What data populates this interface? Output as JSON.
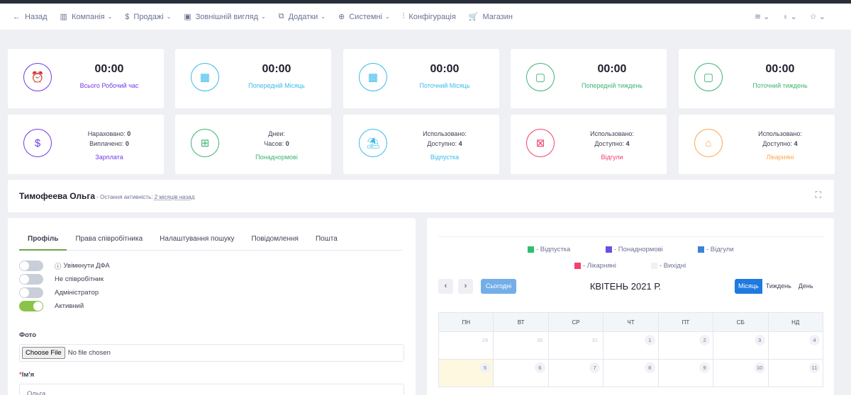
{
  "nav": {
    "items": [
      {
        "icon": "←",
        "label": "Назад",
        "chevron": false
      },
      {
        "icon": "▥",
        "label": "Компанія",
        "chevron": true
      },
      {
        "icon": "$",
        "label": "Продажі",
        "chevron": true
      },
      {
        "icon": "▣",
        "label": "Зовнішній вигляд",
        "chevron": true
      },
      {
        "icon": "⧉",
        "label": "Додатки",
        "chevron": true
      },
      {
        "icon": "⊕",
        "label": "Системні",
        "chevron": true
      },
      {
        "icon": "⫶",
        "label": "Конфігурація",
        "chevron": false
      },
      {
        "icon": "🛒",
        "label": "Магазин",
        "chevron": false
      }
    ],
    "right_icons": [
      "≋ ⌄",
      "♁ ⌄",
      "☆ ⌄"
    ]
  },
  "stats_top": [
    {
      "time": "00:00",
      "label": "Всього Робочий час",
      "color": "#7239ea",
      "icon": "⏰"
    },
    {
      "time": "00:00",
      "label": "Попередній Місяць",
      "color": "#3abbe8",
      "icon": "▦"
    },
    {
      "time": "00:00",
      "label": "Поточний Місяць",
      "color": "#3abbe8",
      "icon": "▦"
    },
    {
      "time": "00:00",
      "label": "Попередній тиждень",
      "color": "#3cb371",
      "icon": "▢"
    },
    {
      "time": "00:00",
      "label": "Поточний тиждень",
      "color": "#3cb371",
      "icon": "▢"
    }
  ],
  "stats_bottom": [
    {
      "line1_label": "Нараховано:",
      "line1_value": "0",
      "line2_label": "Виплачено:",
      "line2_value": "0",
      "label": "Зарплата",
      "color": "#7239ea",
      "icon": "$"
    },
    {
      "line1_label": "Днеи:",
      "line1_value": "",
      "line2_label": "Часов:",
      "line2_value": "0",
      "label": "Понаднормові",
      "color": "#3cb371",
      "icon": "⊞"
    },
    {
      "line1_label": "Использовано:",
      "line1_value": "",
      "line2_label": "Доступно:",
      "line2_value": "4",
      "label": "Відпустка",
      "color": "#3abbe8",
      "icon": "⛱"
    },
    {
      "line1_label": "Использовано:",
      "line1_value": "",
      "line2_label": "Доступно:",
      "line2_value": "4",
      "label": "Відгули",
      "color": "#f1416c",
      "icon": "⊠"
    },
    {
      "line1_label": "Использовано:",
      "line1_value": "",
      "line2_label": "Доступно:",
      "line2_value": "4",
      "label": "Лікарняні",
      "color": "#ffa64d",
      "icon": "⌂"
    }
  ],
  "profile": {
    "name": "Тимофеева Ольга",
    "activity_prefix": " - Остання активність: ",
    "activity_value": "2 місяців назад"
  },
  "tabs": [
    "Профіль",
    "Права співробітника",
    "Налаштування пошуку",
    "Повідомлення",
    "Пошта"
  ],
  "toggles": [
    {
      "label": "Увімкнути ДФА",
      "on": false,
      "info": true
    },
    {
      "label": "Не співробітник",
      "on": false,
      "info": false
    },
    {
      "label": "Адміністратор",
      "on": false,
      "info": false
    },
    {
      "label": "Активний",
      "on": true,
      "info": false
    }
  ],
  "form": {
    "photo_label": "Фото",
    "file_button": "Choose File",
    "file_status": "No file chosen",
    "name_label": "Ім'я",
    "name_value": "Ольга"
  },
  "legend": [
    {
      "label": "- Відпустка",
      "color": "#2ebf6e"
    },
    {
      "label": "- Понаднормові",
      "color": "#6a4fe0"
    },
    {
      "label": "- Відгули",
      "color": "#3a82d9"
    },
    {
      "label": "- Лікарняні",
      "color": "#f1416c"
    },
    {
      "label": "- Вихідні",
      "color": "#eef1f6"
    }
  ],
  "calendar": {
    "prev": "‹",
    "next": "›",
    "today": "Сьогодні",
    "title": "КВІТЕНЬ 2021 Р.",
    "views": [
      "Місяць",
      "Тиждень",
      "День"
    ],
    "weekdays": [
      "ПН",
      "ВТ",
      "СР",
      "ЧТ",
      "ПТ",
      "СБ",
      "НД"
    ],
    "weeks": [
      [
        {
          "d": "29",
          "out": true
        },
        {
          "d": "30",
          "out": true
        },
        {
          "d": "31",
          "out": true
        },
        {
          "d": "1"
        },
        {
          "d": "2"
        },
        {
          "d": "3"
        },
        {
          "d": "4"
        }
      ],
      [
        {
          "d": "5",
          "today": true
        },
        {
          "d": "6"
        },
        {
          "d": "7"
        },
        {
          "d": "8"
        },
        {
          "d": "9"
        },
        {
          "d": "10"
        },
        {
          "d": "11"
        }
      ]
    ]
  }
}
